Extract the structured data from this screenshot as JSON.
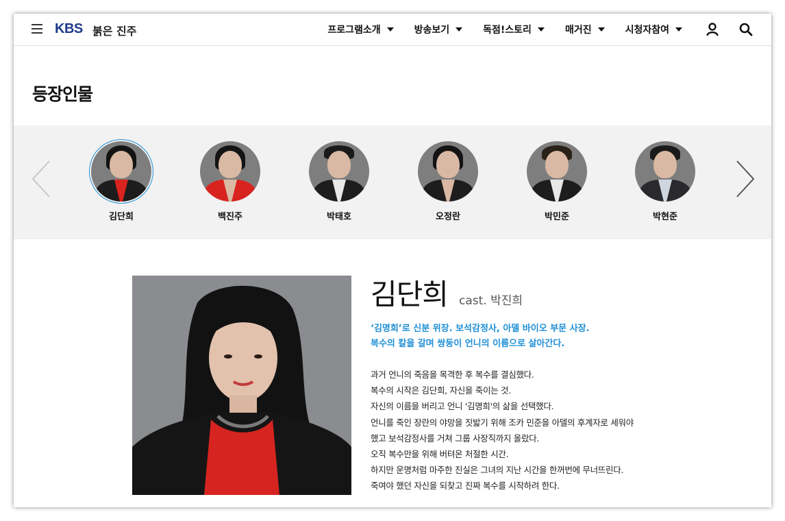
{
  "header": {
    "logo": "KBS",
    "site_title": "붉은 진주",
    "nav": [
      "프로그램소개",
      "방송보기",
      "독점!스토리",
      "매거진",
      "시청자참여"
    ]
  },
  "page_title": "등장인물",
  "cast_list": [
    {
      "name": "김단희",
      "active": true,
      "shirt": "#d9231f",
      "hair": "#141414"
    },
    {
      "name": "백진주",
      "active": false,
      "shirt": "#d9231f",
      "hair": "#141414"
    },
    {
      "name": "박태호",
      "active": false,
      "shirt": "#e8e8e8",
      "hair": "#1a1a1a"
    },
    {
      "name": "오정란",
      "active": false,
      "shirt": "#1d1d1d",
      "hair": "#141414"
    },
    {
      "name": "박민준",
      "active": false,
      "shirt": "#e8e8e8",
      "hair": "#2a2118"
    },
    {
      "name": "박현준",
      "active": false,
      "shirt": "#cfd6e0",
      "hair": "#1a1a1a"
    }
  ],
  "detail": {
    "name": "김단희",
    "cast": "cast. 박진희",
    "tagline": [
      "‘김명희’로 신분 위장. 보석감정사, 아델 바이오 부문 사장.",
      "복수의 칼을 갈며 쌍둥이 언니의 이름으로 살아간다."
    ],
    "description": [
      "과거 언니의 죽음을 목격한 후 복수를 결심했다.",
      "복수의 시작은 김단희, 자신을 죽이는 것.",
      "자신의 이름을 버리고 언니 '김명희'의 삶을 선택했다.",
      "언니를 죽인 장란의 야망을 짓밟기 위해 조카 민준을 아델의 후계자로 세워야",
      "했고 보석감정사를 거쳐 그룹 사장직까지 올랐다.",
      "오직 복수만을 위해 버텨온 처절한 시간.",
      "하지만 운명처럼 마주한 진실은 그녀의 지난 시간을 한꺼번에 무너뜨린다.",
      "죽여야 했던 자신을 되찾고 진짜 복수를 시작하려 한다."
    ]
  },
  "colors": {
    "accent": "#1f8fd6",
    "brand": "#1d3b8a",
    "band_bg": "#f2f2f2"
  },
  "icons": [
    "hamburger-menu-icon",
    "user-icon",
    "search-icon",
    "chevron-left-icon",
    "chevron-right-icon"
  ]
}
